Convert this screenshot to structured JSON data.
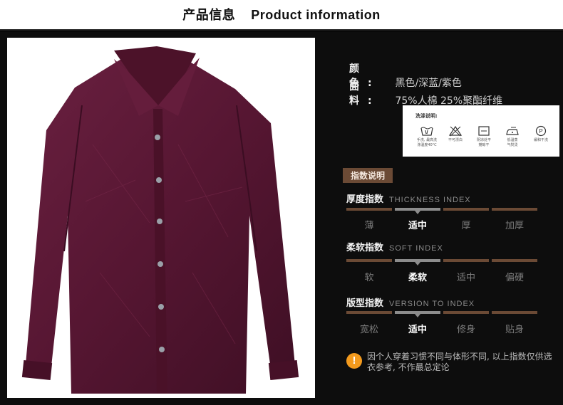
{
  "header": {
    "title": "产品信息    Product information"
  },
  "product": {
    "color_label": "颜  色:",
    "color_value": "黑色/深蓝/紫色",
    "fabric_label": "面  料:",
    "fabric_value": "75%人棉 25%聚酯纤维",
    "shirt_color": "#5a1a33"
  },
  "care": {
    "title": "洗涤说明:",
    "items": [
      {
        "icon": "hand-wash-icon",
        "caption": "手洗, 最高洗\n涤温度40°C"
      },
      {
        "icon": "no-bleach-icon",
        "caption": "不可漂白"
      },
      {
        "icon": "line-dry-icon",
        "caption": "阴凉处平\n摊晾干"
      },
      {
        "icon": "low-iron-icon",
        "caption": "低温蒸\n气熨烫"
      },
      {
        "icon": "dry-clean-icon",
        "caption": "缓和干洗"
      }
    ]
  },
  "index_badge": "指数说明",
  "indices": [
    {
      "title": "厚度指数",
      "subtitle": "THICKNESS INDEX",
      "options": [
        "薄",
        "适中",
        "厚",
        "加厚"
      ],
      "active": 1
    },
    {
      "title": "柔软指数",
      "subtitle": "SOFT INDEX",
      "options": [
        "软",
        "柔软",
        "适中",
        "偏硬"
      ],
      "active": 1
    },
    {
      "title": "版型指数",
      "subtitle": "VERSION TO INDEX",
      "options": [
        "宽松",
        "适中",
        "修身",
        "贴身"
      ],
      "active": 1
    }
  ],
  "note": {
    "icon": "!",
    "text": "因个人穿着习惯不同与体形不同, 以上指数仅供选衣参考, 不作最总定论"
  },
  "colors": {
    "accent_brown": "#6b4a35",
    "active_gray": "#8c8c8c",
    "warning_orange": "#f39a1d"
  }
}
